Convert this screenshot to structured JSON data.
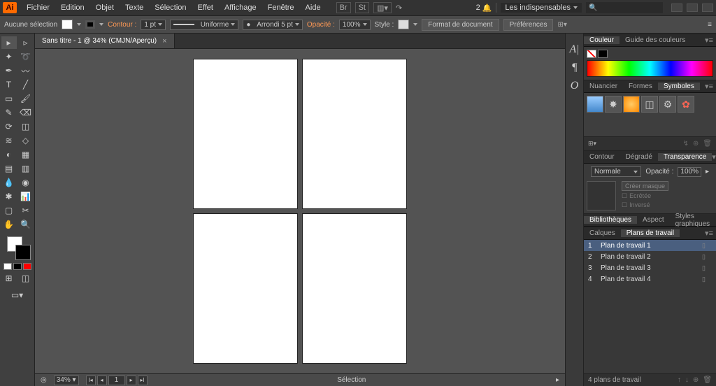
{
  "app_logo_text": "Ai",
  "menu": [
    "Fichier",
    "Edition",
    "Objet",
    "Texte",
    "Sélection",
    "Effet",
    "Affichage",
    "Fenêtre",
    "Aide"
  ],
  "notif_count": "2",
  "workspace": "Les indispensables",
  "search_placeholder": "",
  "control": {
    "selection_info": "Aucune sélection",
    "contour_label": "Contour :",
    "stroke_weight": "1 pt",
    "stroke_style": "Uniforme",
    "corner_style": "Arrondi 5 pt",
    "opacity_label": "Opacité :",
    "opacity_value": "100%",
    "style_label": "Style :",
    "doc_format_btn": "Format de document",
    "prefs_btn": "Préférences"
  },
  "doc_tab": "Sans titre - 1 @ 34% (CMJN/Aperçu)",
  "tools": [
    "⬚",
    "↖",
    "✦",
    "✎",
    "T",
    "/",
    "▭",
    "/",
    "✂",
    "/",
    "⟳",
    "◉",
    "✢",
    "▦",
    "▤",
    "▥",
    "🔍",
    "/",
    "✋",
    "🔍"
  ],
  "right": {
    "color_tab": "Couleur",
    "color_guide_tab": "Guide des couleurs",
    "nuancier_tab": "Nuancier",
    "formes_tab": "Formes",
    "symboles_tab": "Symboles",
    "contour_tab": "Contour",
    "degrade_tab": "Dégradé",
    "transparence_tab": "Transparence",
    "blend_mode": "Normale",
    "opacity_label": "Opacité :",
    "opacity_value": "100%",
    "create_mask": "Créer masque",
    "ecretee": "Ecrêtée",
    "inverse": "Inversé",
    "biblio_tab": "Bibliothèques",
    "aspect_tab": "Aspect",
    "styles_tab": "Styles graphiques",
    "calques_tab": "Calques",
    "artboards_tab": "Plans de travail",
    "artboards": [
      {
        "num": "1",
        "name": "Plan de travail 1"
      },
      {
        "num": "2",
        "name": "Plan de travail 2"
      },
      {
        "num": "3",
        "name": "Plan de travail 3"
      },
      {
        "num": "4",
        "name": "Plan de travail 4"
      }
    ],
    "artboard_count": "4 plans de travail"
  },
  "status": {
    "zoom": "34%",
    "page": "1",
    "tool_name": "Sélection"
  }
}
